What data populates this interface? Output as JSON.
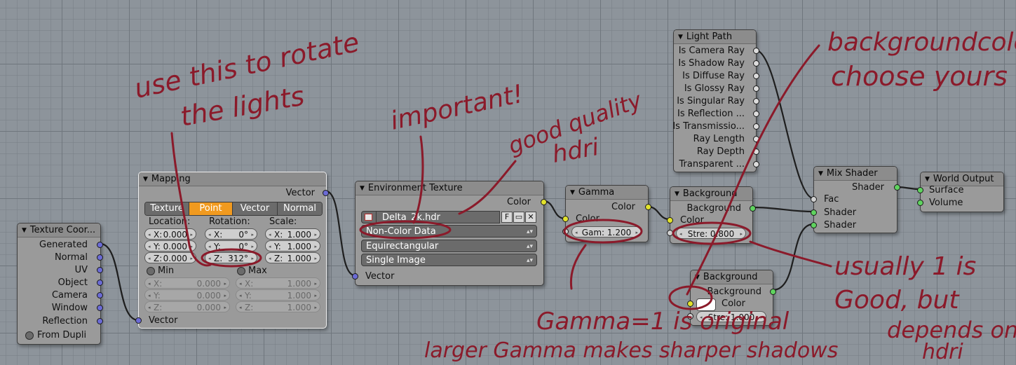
{
  "nodes": {
    "texcoord": {
      "title": "Texture Coor...",
      "outputs": [
        "Generated",
        "Normal",
        "UV",
        "Object",
        "Camera",
        "Window",
        "Reflection"
      ],
      "from_dupli": "From Dupli"
    },
    "mapping": {
      "title": "Mapping",
      "output": "Vector",
      "tabs": [
        "Texture",
        "Point",
        "Vector",
        "Normal"
      ],
      "selected_tab": "Point",
      "location_label": "Location:",
      "rotation_label": "Rotation:",
      "scale_label": "Scale:",
      "location": [
        {
          "axis": "X:",
          "value": "0.000"
        },
        {
          "axis": "Y:",
          "value": "0.000"
        },
        {
          "axis": "Z:",
          "value": "0.000"
        }
      ],
      "rotation": [
        {
          "axis": "X:",
          "value": "0°"
        },
        {
          "axis": "Y:",
          "value": "0°"
        },
        {
          "axis": "Z:",
          "value": "312°"
        }
      ],
      "scale": [
        {
          "axis": "X:",
          "value": "1.000"
        },
        {
          "axis": "Y:",
          "value": "1.000"
        },
        {
          "axis": "Z:",
          "value": "1.000"
        }
      ],
      "min_label": "Min",
      "max_label": "Max",
      "min": [
        {
          "axis": "X:",
          "value": "0.000"
        },
        {
          "axis": "Y:",
          "value": "0.000"
        },
        {
          "axis": "Z:",
          "value": "0.000"
        }
      ],
      "max": [
        {
          "axis": "X:",
          "value": "1.000"
        },
        {
          "axis": "Y:",
          "value": "1.000"
        },
        {
          "axis": "Z:",
          "value": "1.000"
        }
      ],
      "input": "Vector"
    },
    "envtex": {
      "title": "Environment Texture",
      "output": "Color",
      "image_name": "Delta_2k.hdr",
      "fake_user": "F",
      "color_space": "Non-Color Data",
      "projection": "Equirectangular",
      "source": "Single Image",
      "input": "Vector"
    },
    "gamma": {
      "title": "Gamma",
      "output": "Color",
      "input": "Color",
      "gamma_field": "Gam: 1.200"
    },
    "lightpath": {
      "title": "Light Path",
      "outputs": [
        "Is Camera Ray",
        "Is Shadow Ray",
        "Is Diffuse Ray",
        "Is Glossy Ray",
        "Is Singular Ray",
        "Is Reflection ...",
        "Is Transmissio...",
        "Ray Length",
        "Ray Depth",
        "Transparent ..."
      ]
    },
    "background1": {
      "title": "Background",
      "output": "Background",
      "input": "Color",
      "strength_field": "Stre: 0.800"
    },
    "background2": {
      "title": "Background",
      "output": "Background",
      "input": "Color",
      "color_value": "#ffffff",
      "strength_field": "Stre: 1.000"
    },
    "mixshader": {
      "title": "Mix Shader",
      "output": "Shader",
      "inputs": [
        "Fac",
        "Shader",
        "Shader"
      ]
    },
    "worldout": {
      "title": "World Output",
      "inputs": [
        "Surface",
        "Volume"
      ]
    }
  },
  "annotations": {
    "ink_color": "#8b1a2a",
    "rotate_note_line1": "use this to rotate",
    "rotate_note_line2": "the lights",
    "important_note": "important!",
    "quality_note_line1": "good quality",
    "quality_note_line2": "hdri",
    "background_note_line1": "backgroundcolor",
    "background_note_line2": "choose yours",
    "gamma_note_line1": "Gamma=1 is original",
    "gamma_note_line2": "larger Gamma makes sharper shadows",
    "strength_note_line1": "usually 1 is",
    "strength_note_line2": "Good, but",
    "strength_note_line3": "depends on",
    "strength_note_line4": "hdri"
  }
}
